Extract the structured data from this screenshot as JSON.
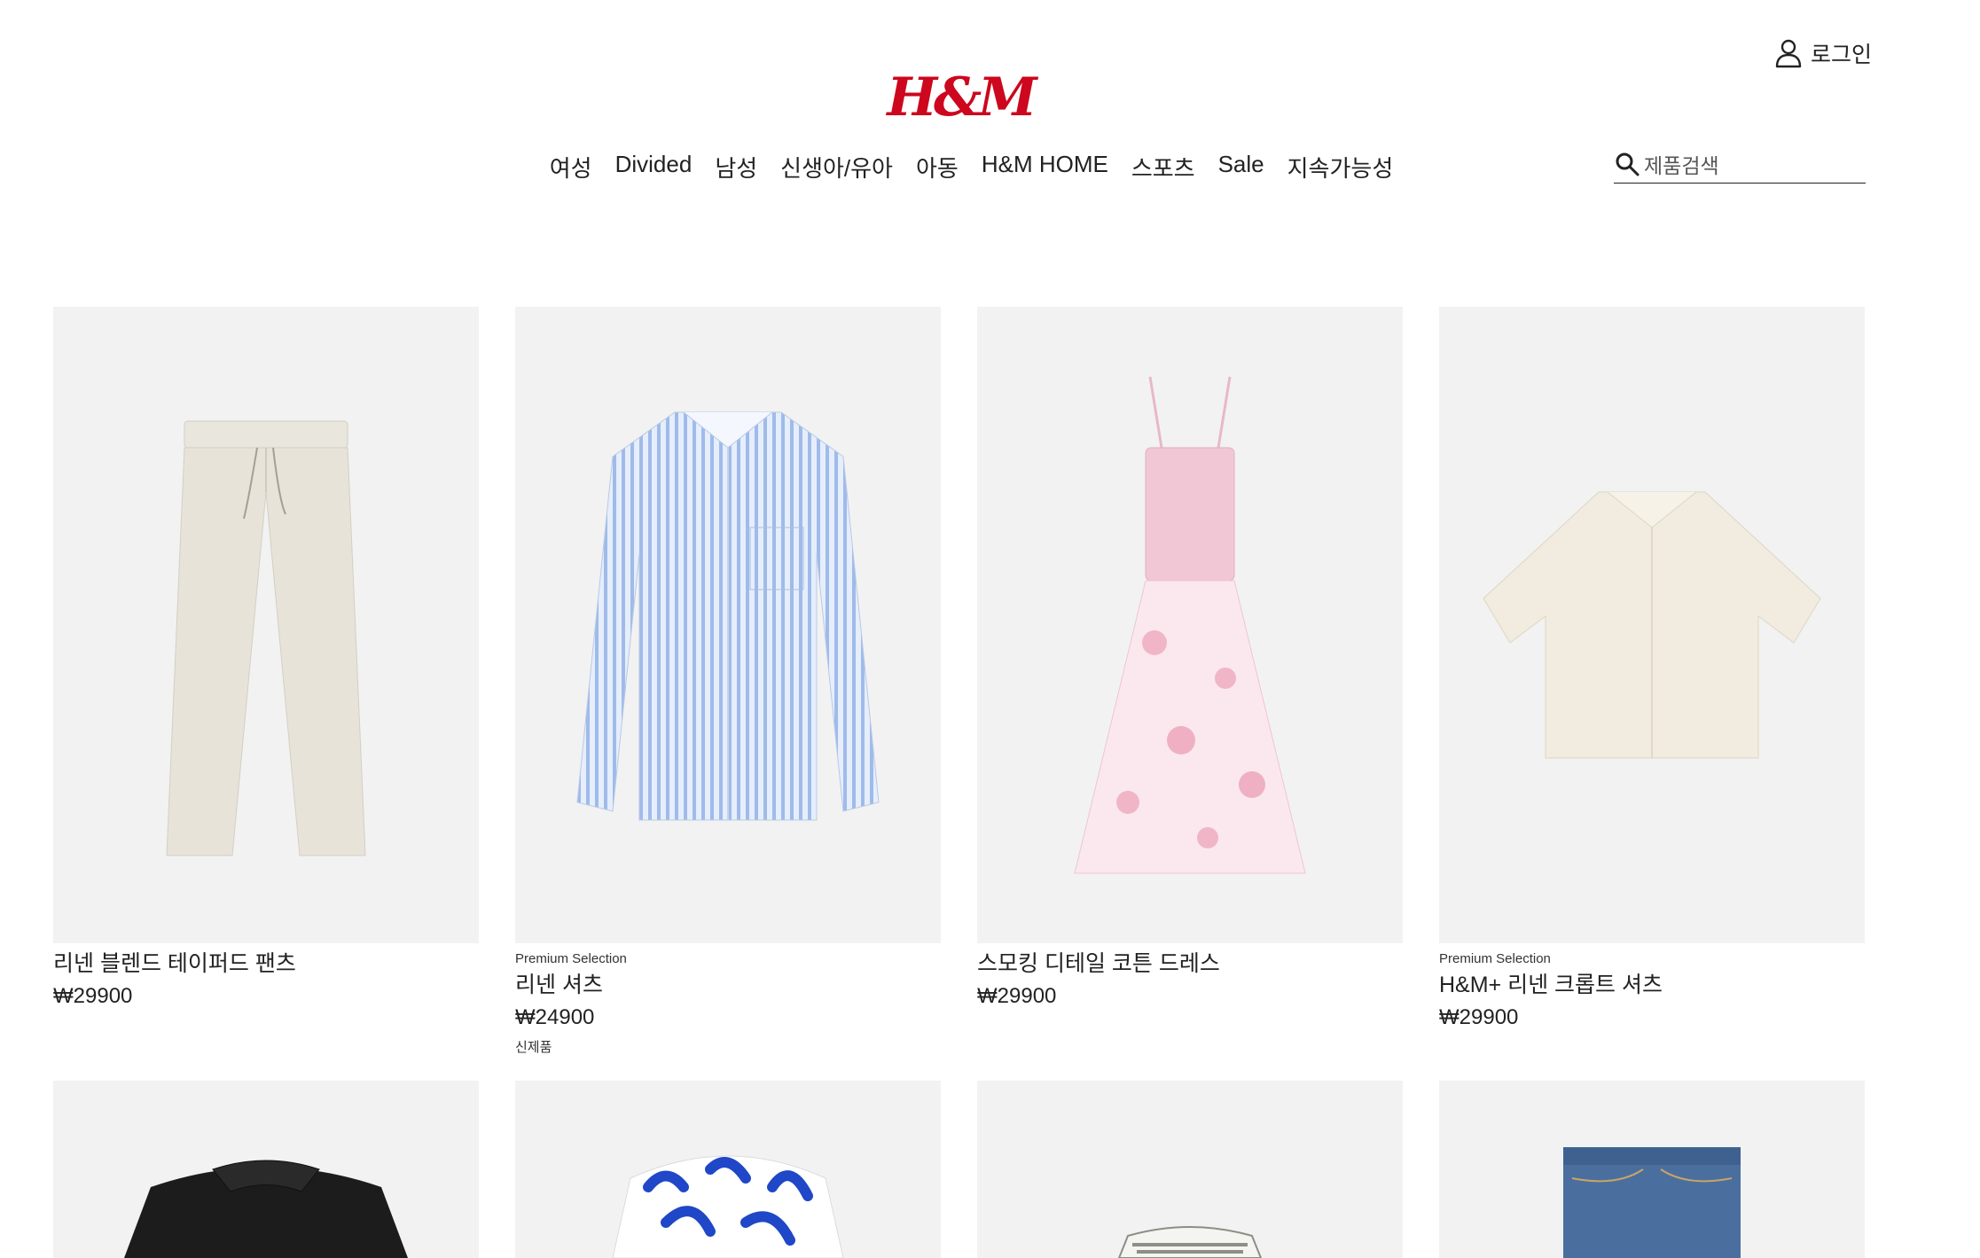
{
  "header": {
    "login_label": "로그인",
    "logo_text": "H&M",
    "brand_color": "#cc071e",
    "search_placeholder": "제품검색"
  },
  "nav": {
    "items": [
      "여성",
      "Divided",
      "남성",
      "신생아/유아",
      "아동",
      "H&M HOME",
      "스포츠",
      "Sale",
      "지속가능성"
    ]
  },
  "products": [
    {
      "tag": "",
      "name": "리넨 블렌드 테이퍼드 팬츠",
      "price": "₩29900",
      "badge": ""
    },
    {
      "tag": "Premium Selection",
      "name": "리넨 셔츠",
      "price": "₩24900",
      "badge": "신제품"
    },
    {
      "tag": "",
      "name": "스모킹 디테일 코튼 드레스",
      "price": "₩29900",
      "badge": ""
    },
    {
      "tag": "Premium Selection",
      "name": "H&M+ 리넨 크롭트 셔츠",
      "price": "₩29900",
      "badge": ""
    }
  ],
  "icons": {
    "login": "user-icon",
    "search": "search-icon"
  }
}
